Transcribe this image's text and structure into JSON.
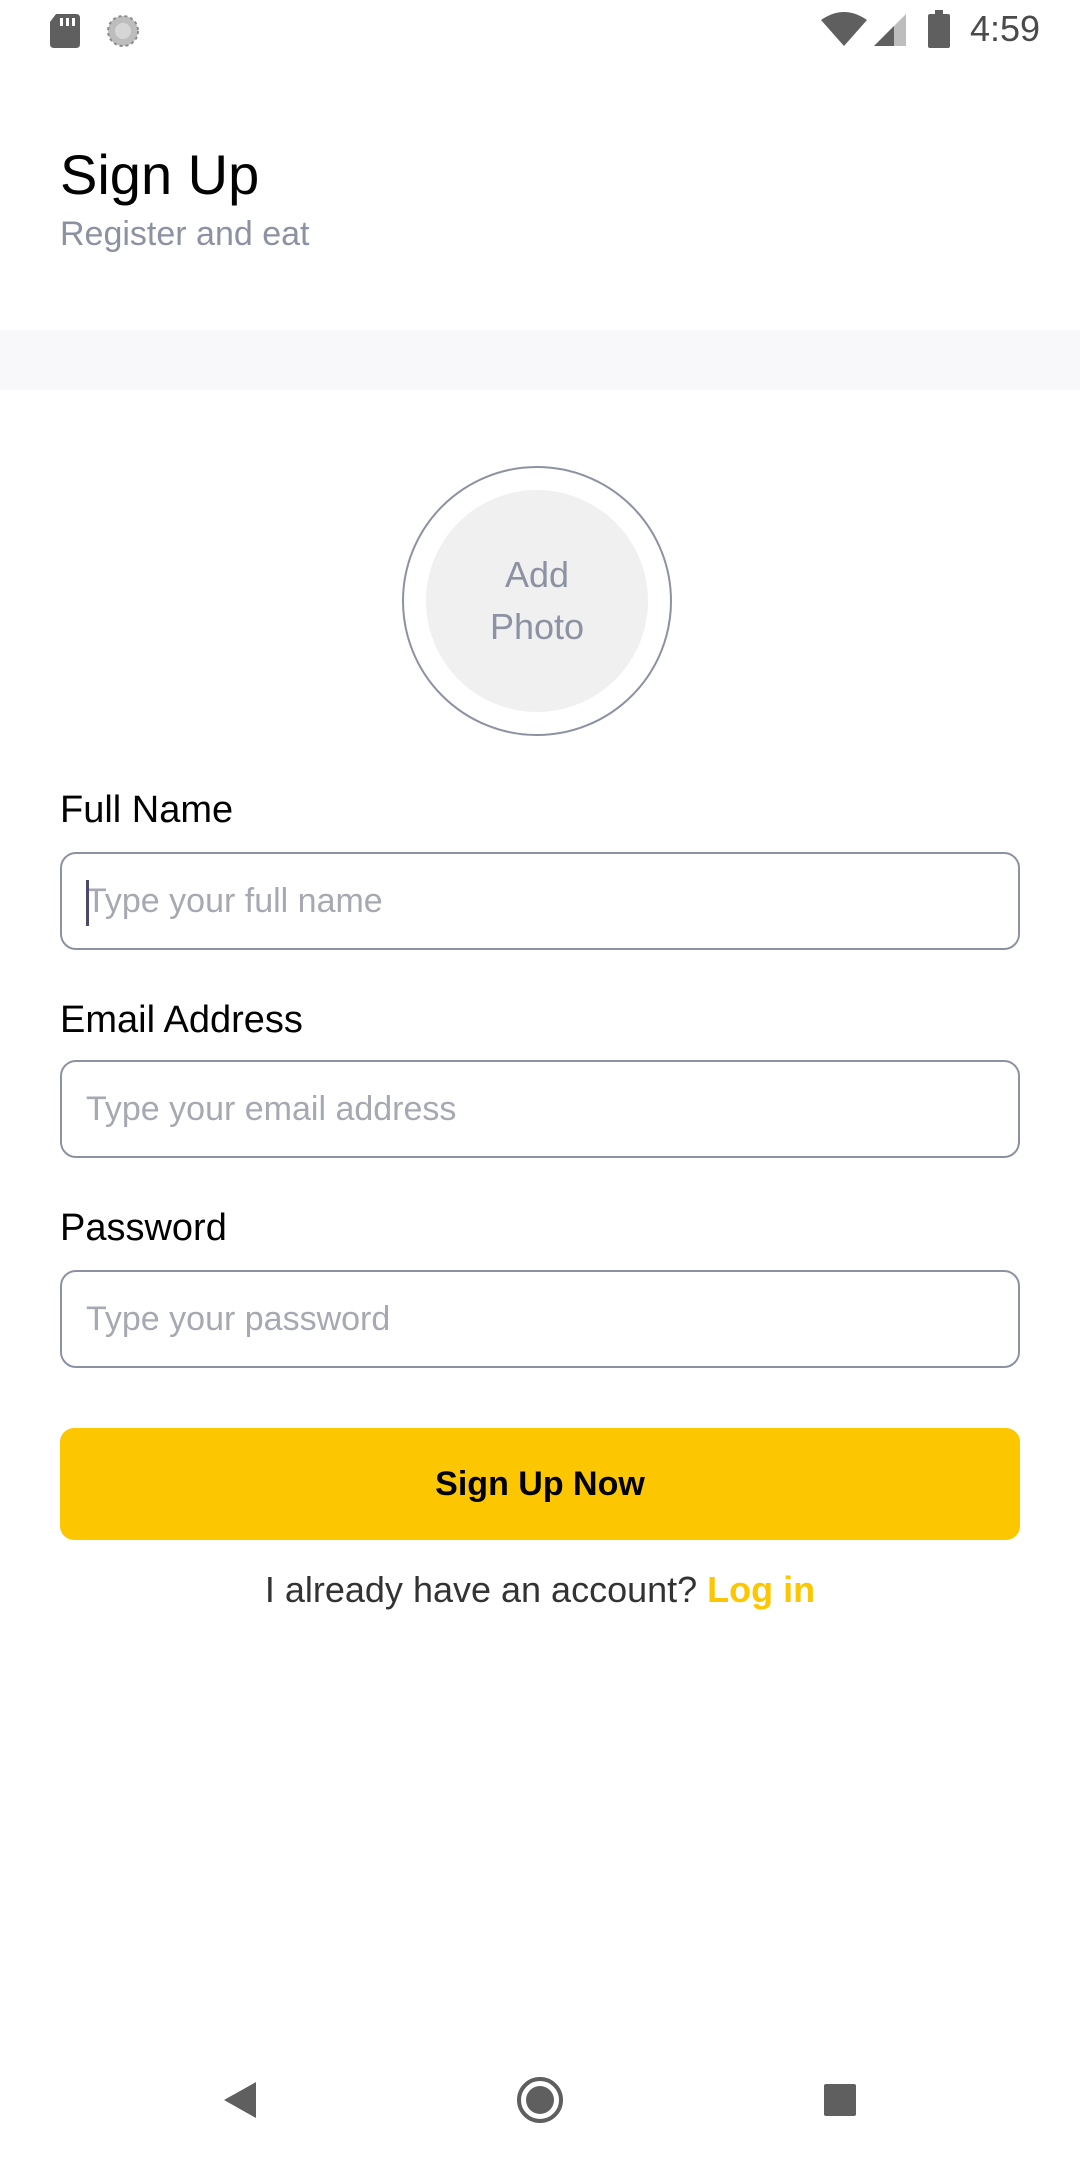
{
  "status_bar": {
    "time": "4:59",
    "icons": [
      "sd-card-icon",
      "sync-icon",
      "wifi-icon",
      "cell-signal-icon",
      "battery-icon"
    ]
  },
  "header": {
    "title": "Sign Up",
    "subtitle": "Register and eat"
  },
  "photo": {
    "line1": "Add",
    "line2": "Photo"
  },
  "form": {
    "full_name": {
      "label": "Full Name",
      "placeholder": "Type your full name",
      "value": ""
    },
    "email": {
      "label": "Email Address",
      "placeholder": "Type your email address",
      "value": ""
    },
    "password": {
      "label": "Password",
      "placeholder": "Type your password",
      "value": ""
    },
    "submit_label": "Sign Up Now"
  },
  "footer": {
    "prompt": "I already have an account? ",
    "link": "Log in"
  },
  "colors": {
    "accent": "#fcc600",
    "muted": "#8d92a3",
    "text": "#020202"
  },
  "nav_bar": {
    "icons": [
      "back-icon",
      "home-icon",
      "recent-apps-icon"
    ]
  }
}
